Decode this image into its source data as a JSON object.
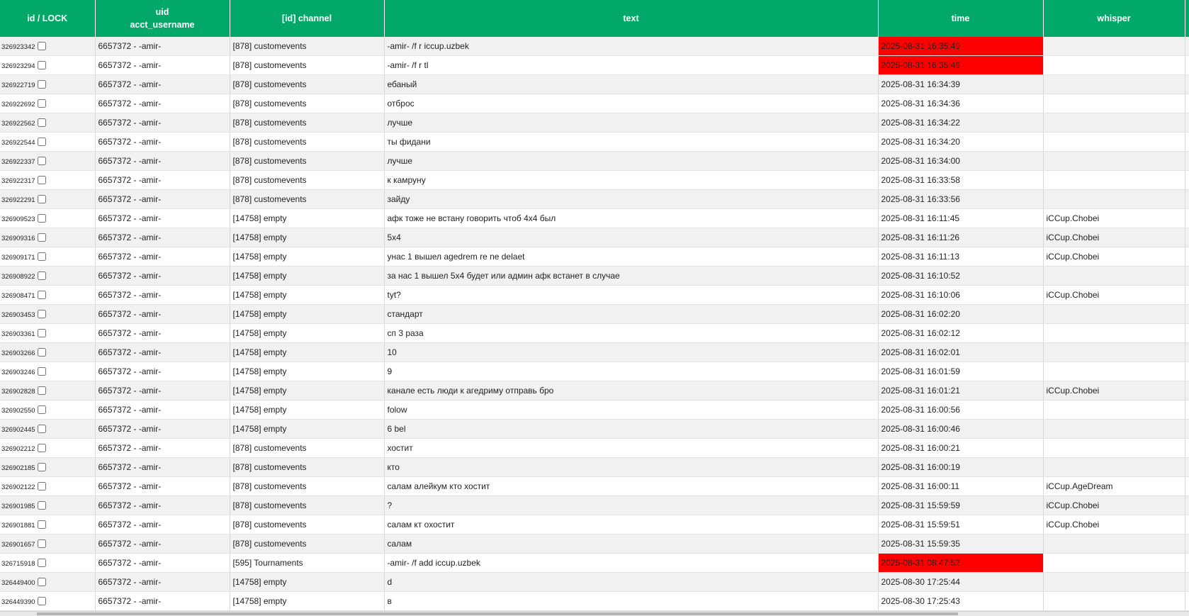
{
  "header": {
    "id_lock": "id / LOCK",
    "uid": "uid",
    "acct_username": "acct_username",
    "channel": "[id] channel",
    "text": "text",
    "time": "time",
    "whisper": "whisper"
  },
  "colors": {
    "header_bg": "#02a86a",
    "highlight": "#ff0000",
    "row_alt": "#f1f1f1"
  },
  "rows": [
    {
      "id": "326923342",
      "user": "6657372 - -amir-",
      "channel": "[878] customevents",
      "text": "-amir- /f r iccup.uzbek",
      "time": "2025-08-31 16:35:49",
      "whisper": "",
      "highlight": true
    },
    {
      "id": "326923294",
      "user": "6657372 - -amir-",
      "channel": "[878] customevents",
      "text": "-amir- /f r tl",
      "time": "2025-08-31 16:35:46",
      "whisper": "",
      "highlight": true
    },
    {
      "id": "326922719",
      "user": "6657372 - -amir-",
      "channel": "[878] customevents",
      "text": "ебаный",
      "time": "2025-08-31 16:34:39",
      "whisper": "",
      "highlight": false
    },
    {
      "id": "326922692",
      "user": "6657372 - -amir-",
      "channel": "[878] customevents",
      "text": "отброс",
      "time": "2025-08-31 16:34:36",
      "whisper": "",
      "highlight": false
    },
    {
      "id": "326922562",
      "user": "6657372 - -amir-",
      "channel": "[878] customevents",
      "text": "лучше",
      "time": "2025-08-31 16:34:22",
      "whisper": "",
      "highlight": false
    },
    {
      "id": "326922544",
      "user": "6657372 - -amir-",
      "channel": "[878] customevents",
      "text": "ты фидани",
      "time": "2025-08-31 16:34:20",
      "whisper": "",
      "highlight": false
    },
    {
      "id": "326922337",
      "user": "6657372 - -amir-",
      "channel": "[878] customevents",
      "text": "лучше",
      "time": "2025-08-31 16:34:00",
      "whisper": "",
      "highlight": false
    },
    {
      "id": "326922317",
      "user": "6657372 - -amir-",
      "channel": "[878] customevents",
      "text": "к камруну",
      "time": "2025-08-31 16:33:58",
      "whisper": "",
      "highlight": false
    },
    {
      "id": "326922291",
      "user": "6657372 - -amir-",
      "channel": "[878] customevents",
      "text": "зайду",
      "time": "2025-08-31 16:33:56",
      "whisper": "",
      "highlight": false
    },
    {
      "id": "326909523",
      "user": "6657372 - -amir-",
      "channel": "[14758] empty",
      "text": "афк тоже не встану говорить чтоб 4х4 был",
      "time": "2025-08-31 16:11:45",
      "whisper": "iCCup.Chobei",
      "highlight": false
    },
    {
      "id": "326909316",
      "user": "6657372 - -amir-",
      "channel": "[14758] empty",
      "text": "5x4",
      "time": "2025-08-31 16:11:26",
      "whisper": "iCCup.Chobei",
      "highlight": false
    },
    {
      "id": "326909171",
      "user": "6657372 - -amir-",
      "channel": "[14758] empty",
      "text": "унас 1 вышел agedrem re ne delaet",
      "time": "2025-08-31 16:11:13",
      "whisper": "iCCup.Chobei",
      "highlight": false
    },
    {
      "id": "326908922",
      "user": "6657372 - -amir-",
      "channel": "[14758] empty",
      "text": "за нас 1 вышел 5х4 будет или админ афк встанет в случае",
      "time": "2025-08-31 16:10:52",
      "whisper": "",
      "highlight": false
    },
    {
      "id": "326908471",
      "user": "6657372 - -amir-",
      "channel": "[14758] empty",
      "text": "tyt?",
      "time": "2025-08-31 16:10:06",
      "whisper": "iCCup.Chobei",
      "highlight": false
    },
    {
      "id": "326903453",
      "user": "6657372 - -amir-",
      "channel": "[14758] empty",
      "text": "стандарт",
      "time": "2025-08-31 16:02:20",
      "whisper": "",
      "highlight": false
    },
    {
      "id": "326903361",
      "user": "6657372 - -amir-",
      "channel": "[14758] empty",
      "text": "сп 3 раза",
      "time": "2025-08-31 16:02:12",
      "whisper": "",
      "highlight": false
    },
    {
      "id": "326903266",
      "user": "6657372 - -amir-",
      "channel": "[14758] empty",
      "text": "10",
      "time": "2025-08-31 16:02:01",
      "whisper": "",
      "highlight": false
    },
    {
      "id": "326903246",
      "user": "6657372 - -amir-",
      "channel": "[14758] empty",
      "text": "9",
      "time": "2025-08-31 16:01:59",
      "whisper": "",
      "highlight": false
    },
    {
      "id": "326902828",
      "user": "6657372 - -amir-",
      "channel": "[14758] empty",
      "text": "канале есть люди к агедриму отправь бро",
      "time": "2025-08-31 16:01:21",
      "whisper": "iCCup.Chobei",
      "highlight": false
    },
    {
      "id": "326902550",
      "user": "6657372 - -amir-",
      "channel": "[14758] empty",
      "text": "folow",
      "time": "2025-08-31 16:00:56",
      "whisper": "",
      "highlight": false
    },
    {
      "id": "326902445",
      "user": "6657372 - -amir-",
      "channel": "[14758] empty",
      "text": "6 bel",
      "time": "2025-08-31 16:00:46",
      "whisper": "",
      "highlight": false
    },
    {
      "id": "326902212",
      "user": "6657372 - -amir-",
      "channel": "[878] customevents",
      "text": "хостит",
      "time": "2025-08-31 16:00:21",
      "whisper": "",
      "highlight": false
    },
    {
      "id": "326902185",
      "user": "6657372 - -amir-",
      "channel": "[878] customevents",
      "text": "кто",
      "time": "2025-08-31 16:00:19",
      "whisper": "",
      "highlight": false
    },
    {
      "id": "326902122",
      "user": "6657372 - -amir-",
      "channel": "[878] customevents",
      "text": "салам алейкум кто хостит",
      "time": "2025-08-31 16:00:11",
      "whisper": "iCCup.AgeDream",
      "highlight": false
    },
    {
      "id": "326901985",
      "user": "6657372 - -amir-",
      "channel": "[878] customevents",
      "text": "?",
      "time": "2025-08-31 15:59:59",
      "whisper": "iCCup.Chobei",
      "highlight": false
    },
    {
      "id": "326901881",
      "user": "6657372 - -amir-",
      "channel": "[878] customevents",
      "text": "салам кт охостит",
      "time": "2025-08-31 15:59:51",
      "whisper": "iCCup.Chobei",
      "highlight": false
    },
    {
      "id": "326901657",
      "user": "6657372 - -amir-",
      "channel": "[878] customevents",
      "text": "салам",
      "time": "2025-08-31 15:59:35",
      "whisper": "",
      "highlight": false
    },
    {
      "id": "326715918",
      "user": "6657372 - -amir-",
      "channel": "[595] Tournaments",
      "text": "-amir- /f add iccup.uzbek",
      "time": "2025-08-31 08:47:52",
      "whisper": "",
      "highlight": true
    },
    {
      "id": "326449400",
      "user": "6657372 - -amir-",
      "channel": "[14758] empty",
      "text": "d",
      "time": "2025-08-30 17:25:44",
      "whisper": "",
      "highlight": false
    },
    {
      "id": "326449390",
      "user": "6657372 - -amir-",
      "channel": "[14758] empty",
      "text": "в",
      "time": "2025-08-30 17:25:43",
      "whisper": "",
      "highlight": false
    }
  ]
}
